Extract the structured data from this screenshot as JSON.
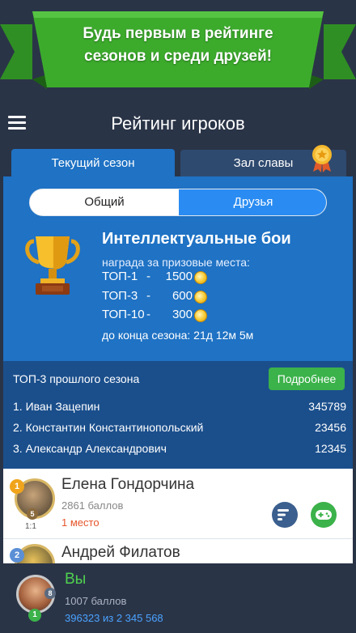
{
  "banner": {
    "line1": "Будь первым в рейтинге",
    "line2": "сезонов и среди друзей!"
  },
  "header": {
    "title": "Рейтинг игроков"
  },
  "tabs": {
    "current": "Текущий сезон",
    "fame": "Зал славы"
  },
  "toggle": {
    "general": "Общий",
    "friends": "Друзья"
  },
  "season": {
    "title": "Интеллектуальные бои",
    "prize_caption": "награда за призовые места:",
    "prizes": [
      {
        "place": "ТОП-1",
        "dash": "-",
        "amount": "1500"
      },
      {
        "place": "ТОП-3",
        "dash": "-",
        "amount": "600"
      },
      {
        "place": "ТОП-10",
        "dash": "-",
        "amount": "300"
      }
    ],
    "ends": "до конца сезона: 21д 12м 5м"
  },
  "top3": {
    "title": "ТОП-3 прошлого сезона",
    "more_label": "Подробнее",
    "rows": [
      {
        "name": "1. Иван Зацепин",
        "score": "345789"
      },
      {
        "name": "2. Константин Константинопольский",
        "score": "23456"
      },
      {
        "name": "3. Александр Александрович",
        "score": "12345"
      }
    ]
  },
  "players": [
    {
      "rank": "1",
      "name": "Елена Гондорчина",
      "score": "2861 баллов",
      "place": "1 место",
      "level": "5",
      "ratio": "1:1"
    },
    {
      "rank": "2",
      "name": "Андрей Филатов"
    }
  ],
  "self": {
    "label": "Вы",
    "score": "1007 баллов",
    "rank": "396323 из 2 345 568",
    "level": "8",
    "badge": "1"
  },
  "colors": {
    "accent_blue": "#1f72c4",
    "toggle_active": "#2a8cf2",
    "banner_green": "#3cab2c",
    "button_green": "#3bb24a",
    "place_orange": "#e5562b"
  }
}
